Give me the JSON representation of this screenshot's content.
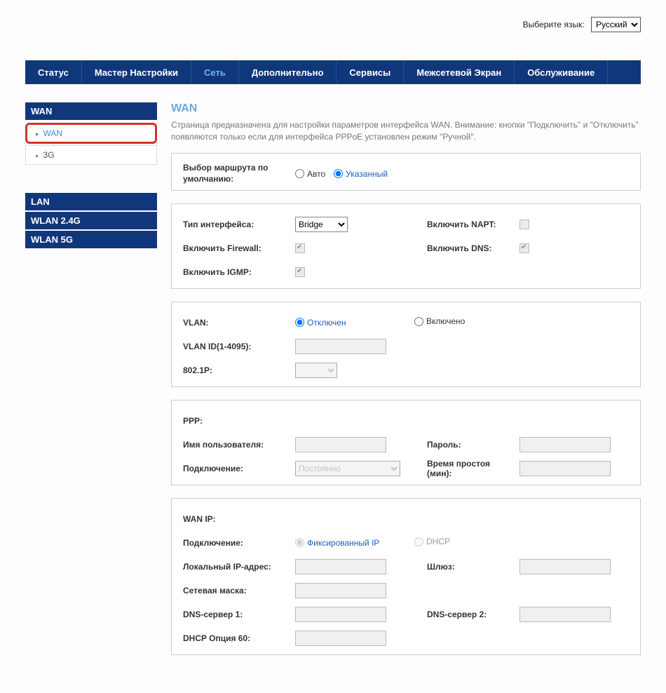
{
  "lang": {
    "label": "Выберите язык:",
    "value": "Русский",
    "options": [
      "Русский"
    ]
  },
  "topnav": {
    "items": [
      "Статус",
      "Мастер Настройки",
      "Сеть",
      "Дополнительно",
      "Сервисы",
      "Межсетевой Экран",
      "Обслуживание"
    ],
    "active_index": 2
  },
  "sidebar": {
    "groups": [
      {
        "title": "WAN",
        "items": [
          {
            "label": "WAN",
            "active": true
          },
          {
            "label": "3G"
          }
        ]
      },
      {
        "title": "LAN"
      },
      {
        "title": "WLAN 2.4G"
      },
      {
        "title": "WLAN 5G"
      }
    ]
  },
  "page_title": "WAN",
  "page_desc": "Страница предназначена для настройки параметров интерфейса WAN. Внимание: кнопки \"Подключить\" и \"Отключить\" появляются только если для интерфейса PPPoE установлен режим \"Ручной\".",
  "route": {
    "label": "Выбор маршрута по умолчанию:",
    "opt_auto": "Авто",
    "opt_specified": "Указанный",
    "selected": "specified"
  },
  "iface": {
    "type_label": "Тип интерфейса:",
    "type_value": "Bridge",
    "type_options": [
      "Bridge"
    ],
    "napt_label": "Включить NAPT:",
    "fw_label": "Включить Firewall:",
    "dns_label": "Включить DNS:",
    "igmp_label": "Включить IGMP:"
  },
  "vlan": {
    "label": "VLAN:",
    "opt_off": "Отключен",
    "opt_on": "Включено",
    "selected": "off",
    "id_label": "VLAN ID(1-4095):",
    "id_value": "",
    "p8021_label": "802.1P:",
    "p8021_value": ""
  },
  "ppp": {
    "ppp_label": "PPP:",
    "user_label": "Имя пользователя:",
    "user_value": "",
    "pass_label": "Пароль:",
    "pass_value": "",
    "conn_label": "Подключение:",
    "conn_value": "Постоянно",
    "conn_options": [
      "Постоянно"
    ],
    "idle_label": "Время простоя (мин):",
    "idle_value": ""
  },
  "wanip": {
    "header": "WAN IP:",
    "conn_label": "Подключение:",
    "opt_fixed": "Фиксированный IP",
    "opt_dhcp": "DHCP",
    "selected": "fixed",
    "local_label": "Локальный IP-адрес:",
    "local_value": "",
    "gw_label": "Шлюз:",
    "gw_value": "",
    "mask_label": "Сетевая маска:",
    "mask_value": "",
    "dns1_label": "DNS-сервер 1:",
    "dns1_value": "",
    "dns2_label": "DNS-сервер 2:",
    "dns2_value": "",
    "dhcp60_label": "DHCP Опция 60:",
    "dhcp60_value": ""
  }
}
